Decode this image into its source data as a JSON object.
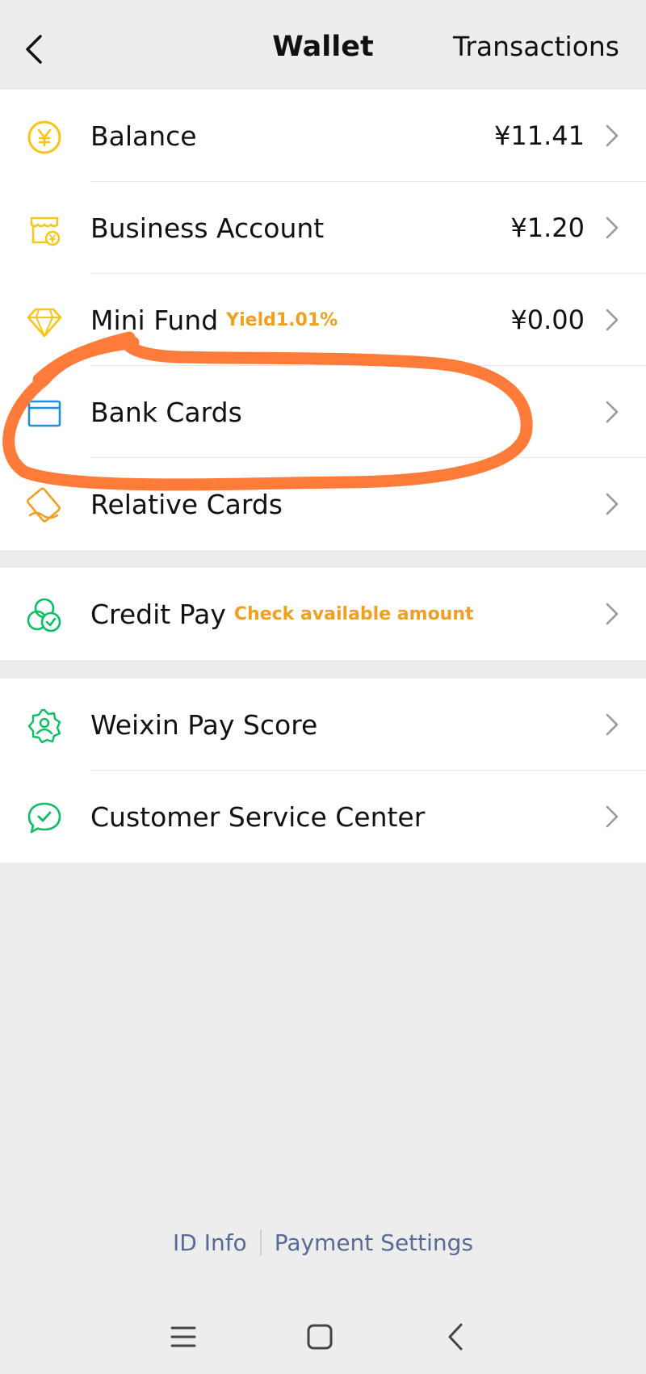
{
  "header": {
    "title": "Wallet",
    "action_label": "Transactions",
    "back_icon": "chevron-left-icon"
  },
  "sections": [
    {
      "rows": [
        {
          "label": "Balance",
          "value": "¥11.41",
          "icon": "yen-coin-icon",
          "icon_color": "#f5c518"
        },
        {
          "label": "Business Account",
          "value": "¥1.20",
          "icon": "shop-yen-icon",
          "icon_color": "#f5c518"
        },
        {
          "label": "Mini Fund",
          "tag": "Yield1.01%",
          "value": "¥0.00",
          "icon": "diamond-icon",
          "icon_color": "#f5c518"
        },
        {
          "label": "Bank Cards",
          "icon": "card-icon",
          "icon_color": "#1e8fd8"
        },
        {
          "label": "Relative Cards",
          "icon": "relative-card-icon",
          "icon_color": "#f0a020"
        }
      ]
    },
    {
      "rows": [
        {
          "label": "Credit Pay",
          "tag": "Check available amount",
          "icon": "credit-pay-icon",
          "icon_color": "#07c160"
        }
      ]
    },
    {
      "rows": [
        {
          "label": "Weixin Pay Score",
          "icon": "pay-score-badge-icon",
          "icon_color": "#07c160"
        },
        {
          "label": "Customer Service Center",
          "icon": "customer-service-icon",
          "icon_color": "#07c160"
        }
      ]
    }
  ],
  "footer": {
    "id_info": "ID Info",
    "payment_settings": "Payment Settings"
  },
  "system_nav": {
    "menu_icon": "menu-icon",
    "home_icon": "home-square-icon",
    "back_icon": "back-chevron-icon"
  },
  "annotation": {
    "type": "hand-drawn circle around Bank Cards",
    "color": "#ff7b3a"
  }
}
